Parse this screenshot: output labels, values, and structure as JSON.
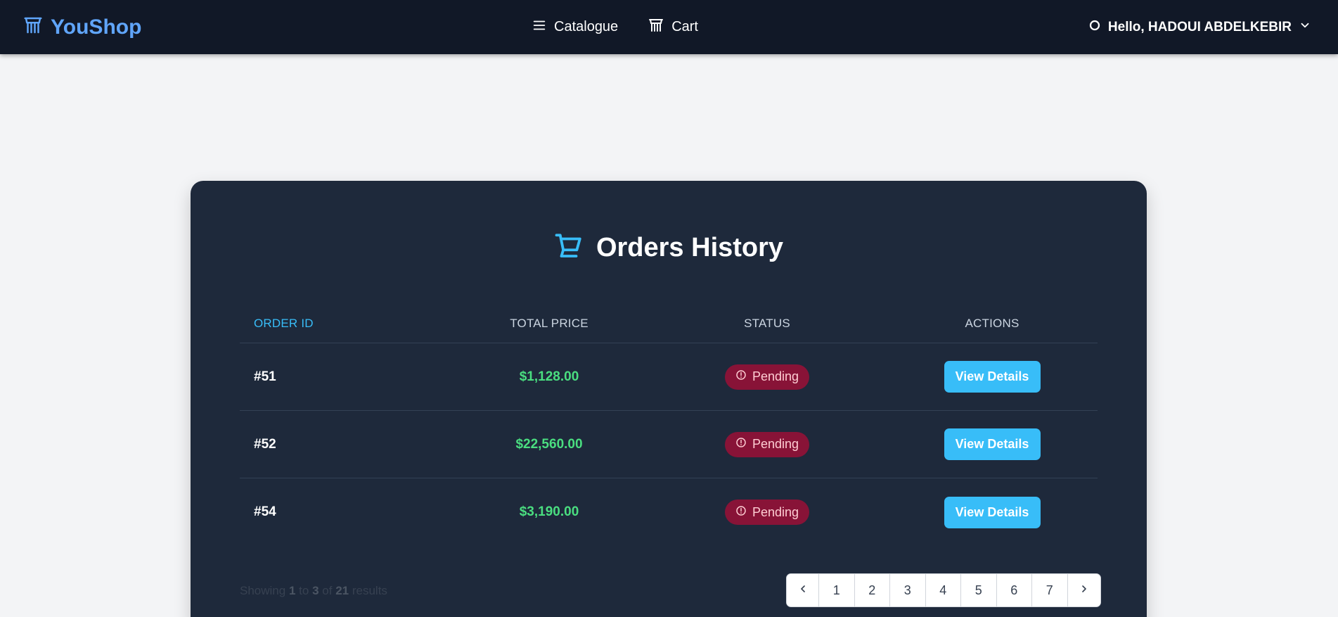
{
  "navbar": {
    "brand": "YouShop",
    "links": [
      {
        "label": "Catalogue",
        "icon": "menu-icon"
      },
      {
        "label": "Cart",
        "icon": "cart-icon"
      }
    ],
    "user_greeting": "Hello, HADOUI ABDELKEBIR"
  },
  "orders": {
    "title": "Orders History",
    "columns": [
      "ORDER ID",
      "TOTAL PRICE",
      "STATUS",
      "ACTIONS"
    ],
    "rows": [
      {
        "id": "#51",
        "total": "$1,128.00",
        "status": "Pending",
        "action": "View Details"
      },
      {
        "id": "#52",
        "total": "$22,560.00",
        "status": "Pending",
        "action": "View Details"
      },
      {
        "id": "#54",
        "total": "$3,190.00",
        "status": "Pending",
        "action": "View Details"
      }
    ]
  },
  "pagination": {
    "showing_prefix": "Showing",
    "from": "1",
    "to_word": "to",
    "to": "3",
    "of_word": "of",
    "total": "21",
    "suffix": "results",
    "pages": [
      "1",
      "2",
      "3",
      "4",
      "5",
      "6",
      "7"
    ]
  },
  "colors": {
    "navbar_bg": "#111827",
    "brand": "#60a5fa",
    "card_bg": "#1e293b",
    "accent": "#38bdf8",
    "price": "#4ade80",
    "pending_badge_bg": "#881337"
  }
}
